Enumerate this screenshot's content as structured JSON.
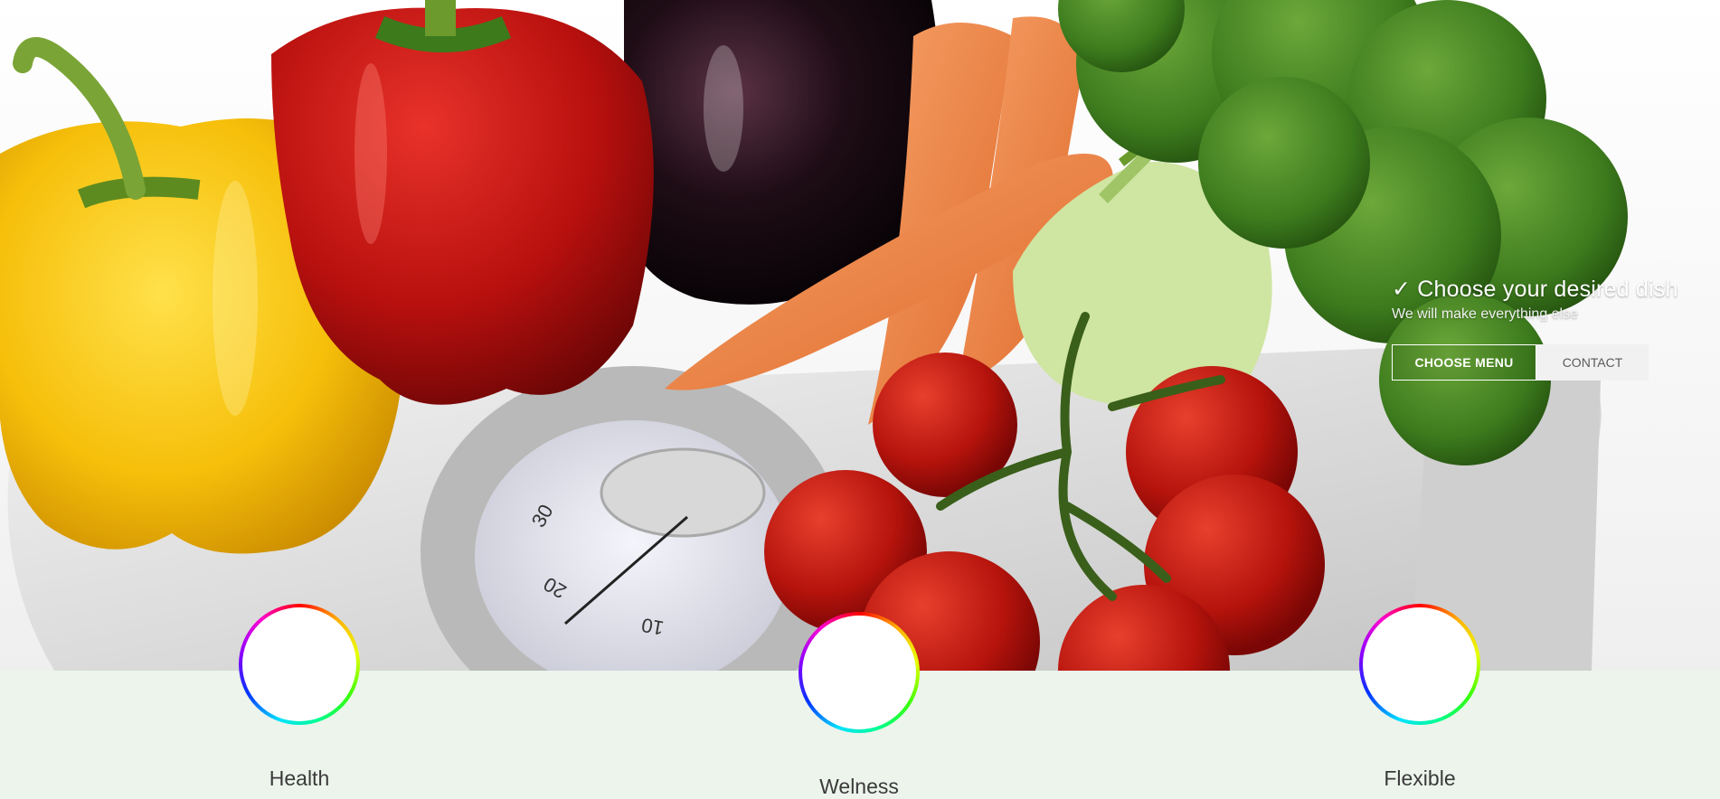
{
  "hero": {
    "caption_title": "✓ Choose your desired dish",
    "caption_subtitle": "We will make everything else",
    "primary_button": "CHOOSE MENU",
    "secondary_button": "CONTACT",
    "scale_numbers": [
      "30",
      "20",
      "10"
    ]
  },
  "features": [
    {
      "label": "Health",
      "icon": "ring-icon"
    },
    {
      "label": "Welness",
      "icon": "ring-icon"
    },
    {
      "label": "Flexible",
      "icon": "ring-icon"
    }
  ],
  "colors": {
    "band_background": "#ecf4ec",
    "button_secondary_bg": "#f1f1f1"
  }
}
